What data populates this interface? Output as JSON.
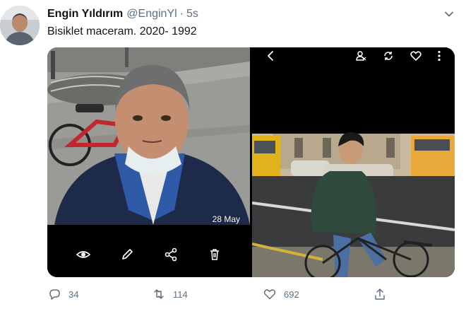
{
  "tweet": {
    "display_name": "Engin Yıldırım",
    "handle": "@EnginYl",
    "separator": "·",
    "time": "5s",
    "text": "Bisiklet maceram. 2020- 1992",
    "more_icon": "chevron-down-icon"
  },
  "media": {
    "left_photo": {
      "description_icon": "photo",
      "date_stamp": "28 May",
      "bottom_bar_icons": [
        "eye-icon",
        "pencil-icon",
        "share-icon",
        "trash-icon"
      ]
    },
    "right_photo": {
      "top_bar_icons": [
        "back-arrow-icon",
        "person-rotate-icon",
        "sync-icon",
        "heart-icon",
        "more-vertical-icon"
      ]
    }
  },
  "actions": {
    "reply": {
      "icon": "reply-icon",
      "count": "34"
    },
    "retweet": {
      "icon": "retweet-icon",
      "count": "114"
    },
    "like": {
      "icon": "heart-icon",
      "count": "692"
    },
    "share": {
      "icon": "share-icon",
      "count": ""
    }
  },
  "colors": {
    "text": "#0f1419",
    "secondary": "#5b7083",
    "media_bg": "#000000"
  }
}
